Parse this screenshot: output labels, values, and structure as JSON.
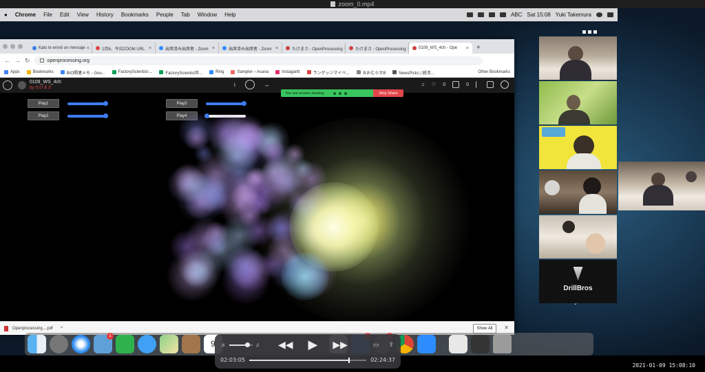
{
  "player": {
    "file_name": "zoom_0.mp4",
    "timestamp": "2021-01-09  15:08:10"
  },
  "menubar": {
    "apple": "",
    "items": [
      "Chrome",
      "File",
      "Edit",
      "View",
      "History",
      "Bookmarks",
      "People",
      "Tab",
      "Window",
      "Help"
    ],
    "right": {
      "input": "ABC",
      "clock": "Sat 15:08",
      "user": "Yuki Takemura"
    }
  },
  "browser": {
    "tabs": [
      {
        "label": "Kato te envió un mensaje",
        "color": "#3b7be0"
      },
      {
        "label": "1月6、今日ZOOM URL",
        "color": "#d44"
      },
      {
        "label": "出席済み出席者 - Zoom",
        "color": "#2d8cff"
      },
      {
        "label": "出席済み出席者 - Zoom",
        "color": "#2d8cff"
      },
      {
        "label": "たけまさ - OpenProcessing",
        "color": "#c44"
      },
      {
        "label": "たけまさ - OpenProcessing",
        "color": "#c44"
      },
      {
        "label": "0109_WS_4ch - Ope",
        "color": "#c44",
        "active": true
      }
    ],
    "new_tab": "+",
    "url": "openprocessing.org",
    "bookmarks": [
      "Apps",
      "Bookmarks",
      "BIO関連メモ - Goo...",
      "FactoryScientist-...",
      "FactoryScientist世...",
      "Ring",
      "Sampler – Asana",
      "Instagantt",
      "ランゲッジマイベ...",
      "ＢおむらせB",
      "NewsPicks | 経済..."
    ],
    "other_bookmarks": "Other Bookmarks",
    "download": {
      "file": "Openprocessing....pdf",
      "chevron": "⌃",
      "show_all": "Show All",
      "close": "✕"
    }
  },
  "openprocessing": {
    "sketch_title": "0109_WS_4ch",
    "author": "by たけまさ",
    "center_icons": [
      "i",
      "⟳",
      "↔"
    ],
    "like_count": "0",
    "comment_count": "0",
    "controls": [
      {
        "label": "Play1",
        "level": 1.0,
        "color": "#3d7bf2"
      },
      {
        "label": "Play2",
        "level": 1.0,
        "color": "#3d7bf2"
      },
      {
        "label": "Play3",
        "level": 1.0,
        "color": "#3d7bf2"
      },
      {
        "label": "Play4",
        "level": 0.0,
        "color": "#eeeeee"
      }
    ]
  },
  "zoom": {
    "share_status": "You are screen sharing",
    "stop_share": "Stop Share",
    "participant_tiles": 6,
    "last_tile_logo": "DrillBros",
    "more": "⌄"
  },
  "playback": {
    "current_time": "02:03:05",
    "total_time": "02:24:37",
    "progress": 0.851,
    "volume": 0.75,
    "buttons": {
      "rewind": "◀◀",
      "play": "▶",
      "forward": "▶▶",
      "airplay": "▭",
      "share": "⇪"
    }
  }
}
